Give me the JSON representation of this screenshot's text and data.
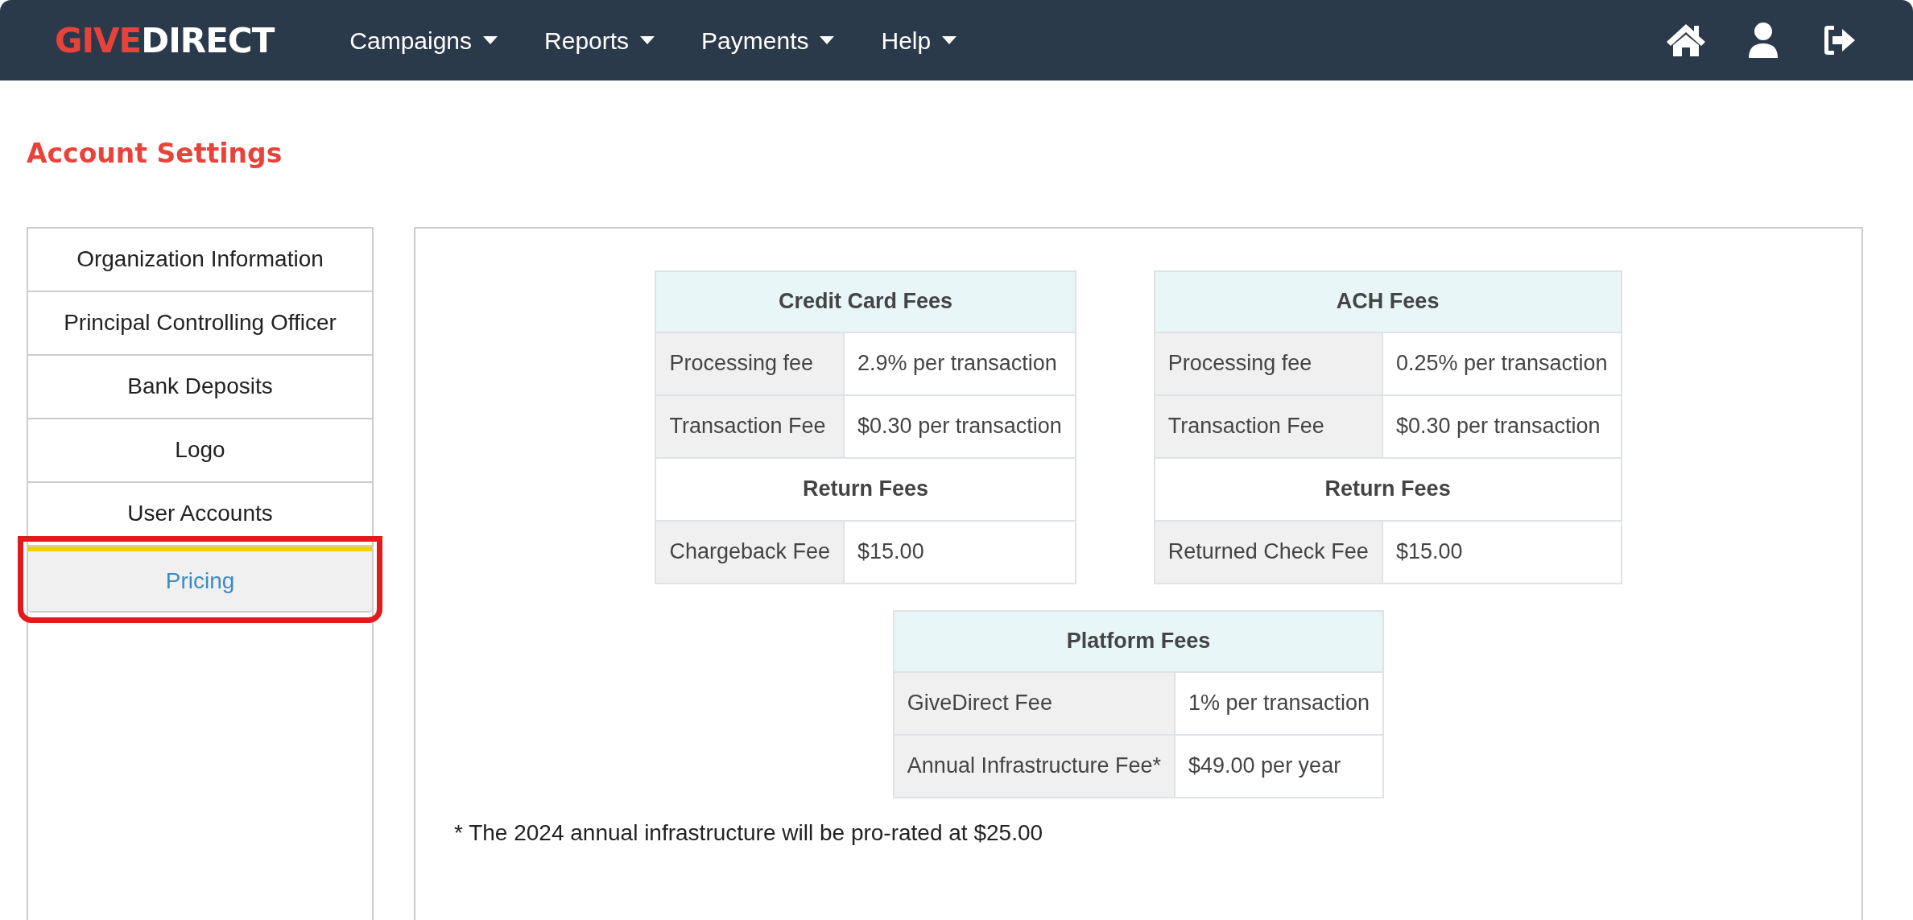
{
  "navbar": {
    "logo": {
      "part_1": "GIVE",
      "part_2": "DIRECT"
    },
    "menu": [
      {
        "label": "Campaigns"
      },
      {
        "label": "Reports"
      },
      {
        "label": "Payments"
      },
      {
        "label": "Help"
      }
    ]
  },
  "page_title": "Account Settings",
  "sidebar": {
    "items": [
      {
        "label": "Organization Information",
        "selected": false,
        "highlighted": false
      },
      {
        "label": "Principal Controlling Officer",
        "selected": false,
        "highlighted": false
      },
      {
        "label": "Bank Deposits",
        "selected": false,
        "highlighted": false
      },
      {
        "label": "Logo",
        "selected": false,
        "highlighted": false
      },
      {
        "label": "User Accounts",
        "selected": false,
        "highlighted": false
      },
      {
        "label": "Pricing",
        "selected": true,
        "highlighted": true
      }
    ]
  },
  "table_rows": [
    [
      {
        "title": "Credit Card Fees",
        "rows": [
          {
            "kind": "fee",
            "label": "Processing fee",
            "value": "2.9% per transaction"
          },
          {
            "kind": "fee",
            "label": "Transaction Fee",
            "value": "$0.30 per transaction"
          },
          {
            "kind": "subheader",
            "label": "Return Fees"
          },
          {
            "kind": "fee",
            "label": "Chargeback Fee",
            "value": "$15.00"
          }
        ]
      },
      {
        "title": "ACH Fees",
        "rows": [
          {
            "kind": "fee",
            "label": "Processing fee",
            "value": "0.25% per transaction"
          },
          {
            "kind": "fee",
            "label": "Transaction Fee",
            "value": "$0.30 per transaction"
          },
          {
            "kind": "subheader",
            "label": "Return Fees"
          },
          {
            "kind": "fee",
            "label": "Returned Check Fee",
            "value": "$15.00"
          }
        ]
      }
    ],
    [
      {
        "title": "Platform Fees",
        "rows": [
          {
            "kind": "fee",
            "label": "GiveDirect Fee",
            "value": "1% per transaction"
          },
          {
            "kind": "fee",
            "label": "Annual Infrastructure Fee*",
            "value": "$49.00 per year"
          }
        ]
      }
    ]
  ],
  "footnote": "* The 2024 annual infrastructure will be pro-rated at $25.00"
}
